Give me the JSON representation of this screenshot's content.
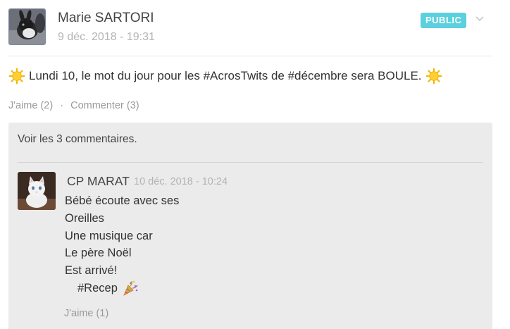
{
  "post": {
    "author": "Marie SARTORI",
    "timestamp": "9 déc. 2018 - 19:31",
    "visibility_badge": "PUBLIC",
    "text": "Lundi 10, le mot du jour pour les #AcrosTwits de #décembre sera BOULE.",
    "actions": {
      "like_label": "J'aime (2)",
      "separator": "·",
      "comment_label": "Commenter (3)"
    }
  },
  "comments": {
    "see_all_label": "Voir les 3 commentaires.",
    "items": [
      {
        "author": "CP MARAT",
        "timestamp": "10 déc. 2018 - 10:24",
        "lines": [
          "Bébé écoute avec ses",
          "Oreilles",
          "Une musique car",
          "Le père Noël",
          "Est arrivé!",
          "#Recep"
        ],
        "like_label": "J'aime (1)"
      }
    ]
  },
  "colors": {
    "badge": "#5bd0de",
    "muted_text": "#9a9a9a",
    "comment_bg": "#ebebeb"
  },
  "icons": {
    "sun": "sun-emoji-icon",
    "party": "party-popper-emoji-icon",
    "chevron": "chevron-down-icon"
  }
}
